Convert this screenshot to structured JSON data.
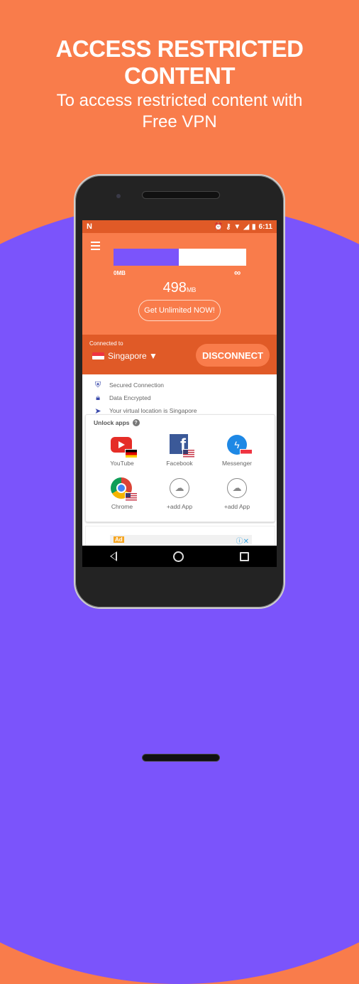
{
  "promo": {
    "headline": "ACCESS RESTRICTED CONTENT",
    "subline_1": "To access restricted content with",
    "subline_2": "Free VPN"
  },
  "colors": {
    "brand_orange": "#f97c4b",
    "dark_orange": "#e05a27",
    "accent_purple": "#7b54fb"
  },
  "statusbar": {
    "left_icon": "notification-n-icon",
    "icons": [
      "alarm-icon",
      "vpn-key-icon",
      "wifi-icon",
      "signal-icon",
      "battery-icon"
    ],
    "time": "6:11"
  },
  "usage": {
    "min_label": "0MB",
    "max_label": "∞",
    "fill_fraction": 0.49,
    "value": "498",
    "unit": "MB",
    "cta_label": "Get Unlimited NOW!"
  },
  "connection": {
    "label": "Connected to",
    "country": "Singapore ▼",
    "disconnect_label": "DISCONNECT"
  },
  "status_items": [
    {
      "icon": "shield-icon",
      "text": "Secured Connection"
    },
    {
      "icon": "lock-icon",
      "text": "Data Encrypted"
    },
    {
      "icon": "location-arrow-icon",
      "text": "Your virtual location is Singapore"
    }
  ],
  "unlock": {
    "title": "Unlock apps",
    "apps": [
      {
        "name": "YouTube",
        "flag": "germany"
      },
      {
        "name": "Facebook",
        "flag": "usa"
      },
      {
        "name": "Messenger",
        "flag": "singapore"
      },
      {
        "name": "Chrome",
        "flag": "usa"
      },
      {
        "name": "+add App"
      },
      {
        "name": "+add App"
      }
    ]
  },
  "ad": {
    "badge": "Ad",
    "controls": "ⓘ✕"
  }
}
